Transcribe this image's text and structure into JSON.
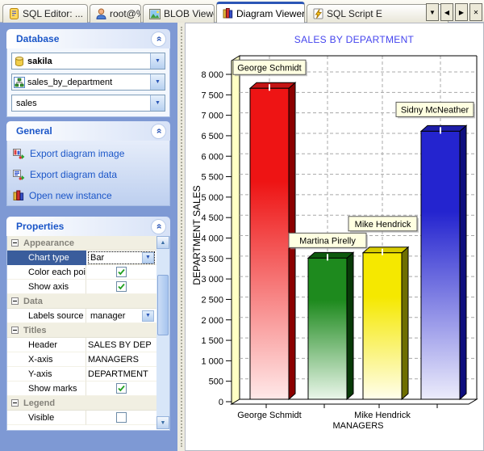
{
  "tabs": {
    "items": [
      {
        "label": "SQL Editor: ...",
        "icon": "sql-editor-icon",
        "active": false
      },
      {
        "label": "root@%",
        "icon": "user-icon",
        "active": false
      },
      {
        "label": "BLOB Viewer",
        "icon": "image-icon",
        "active": false
      },
      {
        "label": "Diagram Viewer",
        "icon": "diagram-icon",
        "active": true
      },
      {
        "label": "SQL Script E",
        "icon": "script-icon",
        "active": false
      }
    ],
    "nav_buttons": [
      {
        "name": "tab-menu-button",
        "glyph": "▼"
      },
      {
        "name": "scroll-tabs-left-button",
        "glyph": "◀"
      },
      {
        "name": "scroll-tabs-right-button",
        "glyph": "▶"
      },
      {
        "name": "close-tab-button",
        "glyph": "✕"
      }
    ]
  },
  "sidebar": {
    "database": {
      "title": "Database",
      "combos": [
        {
          "value": "sakila",
          "icon": "database-icon",
          "bold": true
        },
        {
          "value": "sales_by_department",
          "icon": "view-icon",
          "bold": false
        },
        {
          "value": "sales",
          "icon": "",
          "bold": false
        }
      ]
    },
    "general": {
      "title": "General",
      "links": [
        {
          "label": "Export diagram image",
          "icon": "export-image-icon"
        },
        {
          "label": "Export diagram data",
          "icon": "export-data-icon"
        },
        {
          "label": "Open new instance",
          "icon": "new-instance-icon"
        }
      ]
    },
    "properties": {
      "title": "Properties",
      "rows": [
        {
          "type": "category",
          "label": "Appearance"
        },
        {
          "type": "dropdown",
          "label": "Chart type",
          "value": "Bar",
          "selected": true
        },
        {
          "type": "checkbox",
          "label": "Color each poir",
          "checked": true
        },
        {
          "type": "checkbox",
          "label": "Show axis",
          "checked": true
        },
        {
          "type": "category",
          "label": "Data"
        },
        {
          "type": "dropdown",
          "label": "Labels source",
          "value": "manager",
          "selected": false
        },
        {
          "type": "category",
          "label": "Titles"
        },
        {
          "type": "text",
          "label": "Header",
          "value": "SALES BY DEP"
        },
        {
          "type": "text",
          "label": "X-axis",
          "value": "MANAGERS"
        },
        {
          "type": "text",
          "label": "Y-axis",
          "value": "DEPARTMENT"
        },
        {
          "type": "checkbox",
          "label": "Show marks",
          "checked": true
        },
        {
          "type": "category",
          "label": "Legend"
        },
        {
          "type": "checkbox",
          "label": "Visible",
          "checked": false
        }
      ]
    }
  },
  "chart_data": {
    "type": "bar",
    "title": "SALES BY DEPARTMENT",
    "title_color": "#4545EE",
    "xlabel": "MANAGERS",
    "ylabel": "DEPARTMENT SALES",
    "categories": [
      "George Schmidt",
      "Martina Pirelly",
      "Mike Hendrick",
      "Sidny McNeather"
    ],
    "values": [
      7600,
      3450,
      3580,
      6550
    ],
    "point_labels": [
      "George Schmidt",
      "Martina Pirelly",
      "Mike Hendrick",
      "Sidny McNeather"
    ],
    "x_tick_labels_shown": [
      "George Schmidt",
      "Mike Hendrick"
    ],
    "ylim": [
      0,
      8000
    ],
    "ytick_step": 500,
    "grid": true,
    "legend": false,
    "wall_color": "#FFFFC4",
    "colors": [
      {
        "front": "#EE1414",
        "light": "#FFE9E9",
        "side": "#8B0000",
        "top": "#C41414"
      },
      {
        "front": "#1E8A1E",
        "light": "#EAF6EA",
        "side": "#083A08",
        "top": "#0E5A0E"
      },
      {
        "front": "#F5E800",
        "light": "#FFFEEC",
        "side": "#6E6E00",
        "top": "#D8CC00"
      },
      {
        "front": "#2424CF",
        "light": "#ECECFB",
        "side": "#0E0E7E",
        "top": "#1E1EA8"
      }
    ],
    "mark_offsets": [
      17,
      13,
      27,
      18
    ]
  }
}
